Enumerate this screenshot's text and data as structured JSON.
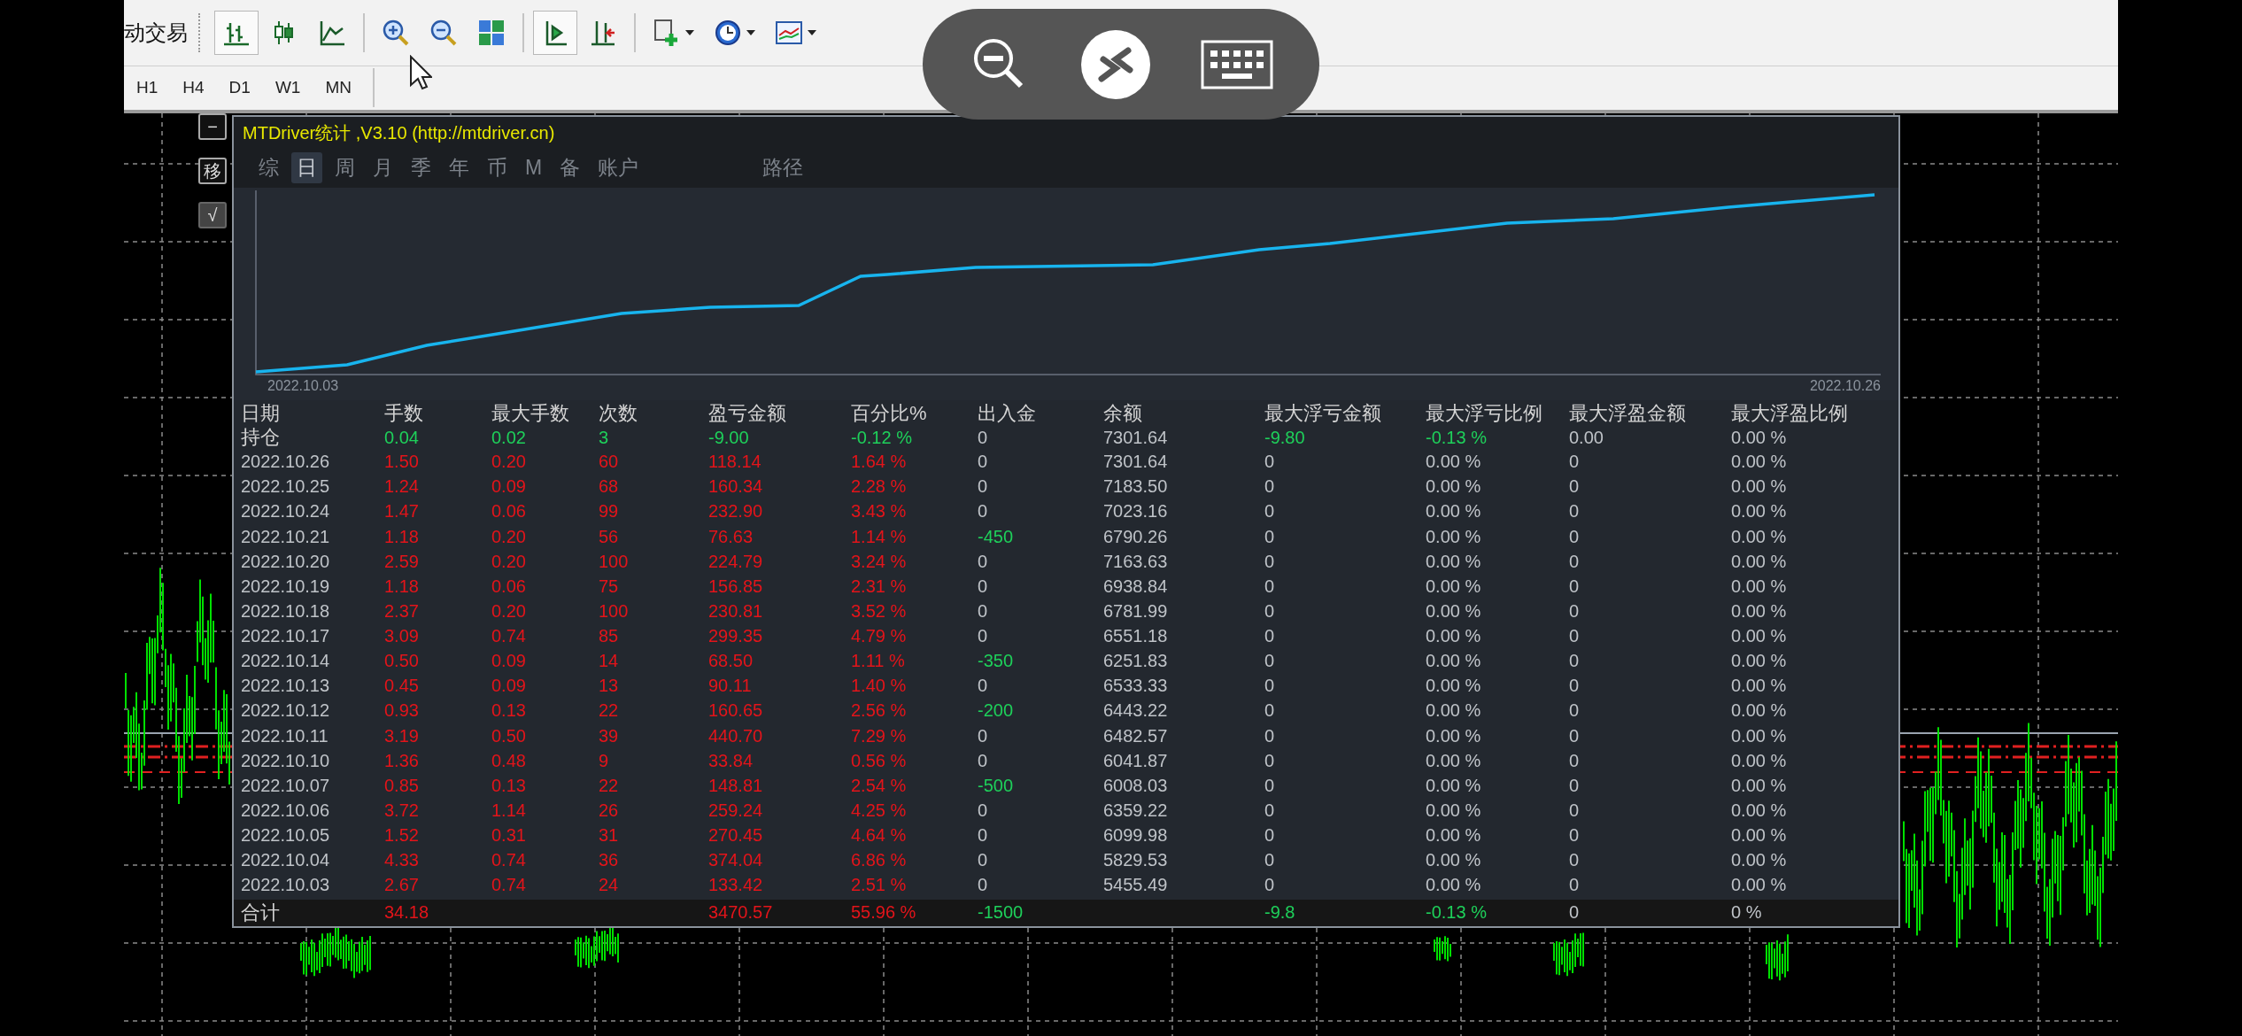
{
  "toolbar": {
    "label": "动交易",
    "tools": [
      {
        "kind": "bars",
        "pressed": true,
        "menu": false
      },
      {
        "kind": "candles",
        "pressed": false,
        "menu": false
      },
      {
        "kind": "line",
        "pressed": false,
        "menu": false
      },
      {
        "kind": "zoom-in",
        "pressed": false,
        "menu": false
      },
      {
        "kind": "zoom-out",
        "pressed": false,
        "menu": false
      },
      {
        "kind": "tile",
        "pressed": false,
        "menu": false
      },
      {
        "kind": "autoscroll",
        "pressed": true,
        "menu": false
      },
      {
        "kind": "shift",
        "pressed": false,
        "menu": false
      },
      {
        "kind": "indicators",
        "pressed": false,
        "menu": true
      },
      {
        "kind": "clock",
        "pressed": false,
        "menu": true
      },
      {
        "kind": "template",
        "pressed": false,
        "menu": true
      }
    ],
    "timeframes": [
      "H1",
      "H4",
      "D1",
      "W1",
      "MN"
    ]
  },
  "side_buttons": [
    "−",
    "移",
    "√"
  ],
  "panel": {
    "title": "MTDriver统计 ,V3.10 (http://mtdriver.cn)",
    "tabs": [
      {
        "label": "综",
        "selected": false
      },
      {
        "label": "日",
        "selected": true
      },
      {
        "label": "周",
        "selected": false
      },
      {
        "label": "月",
        "selected": false
      },
      {
        "label": "季",
        "selected": false
      },
      {
        "label": "年",
        "selected": false
      },
      {
        "label": "币",
        "selected": false
      },
      {
        "label": "M",
        "selected": false
      },
      {
        "label": "备",
        "selected": false
      },
      {
        "label": "账户",
        "selected": false
      }
    ],
    "path_tab": {
      "label": "路径",
      "selected": false
    },
    "chart": {
      "start_label": "2022.10.03",
      "end_label": "2022.10.26"
    },
    "columns": [
      "日期",
      "手数",
      "最大手数",
      "次数",
      "盈亏金额",
      "百分比%",
      "出入金",
      "余额",
      "最大浮亏金额",
      "最大浮亏比例",
      "最大浮盈金额",
      "最大浮盈比例"
    ],
    "rows": [
      {
        "kind": "position",
        "deposit_out": false,
        "cells": [
          "持仓",
          "0.04",
          "0.02",
          "3",
          "-9.00",
          "-0.12 %",
          "0",
          "7301.64",
          "-9.80",
          "-0.13 %",
          "0.00",
          "0.00 %"
        ]
      },
      {
        "kind": "day",
        "deposit_out": false,
        "cells": [
          "2022.10.26",
          "1.50",
          "0.20",
          "60",
          "118.14",
          "1.64 %",
          "0",
          "7301.64",
          "0",
          "0.00 %",
          "0",
          "0.00 %"
        ]
      },
      {
        "kind": "day",
        "deposit_out": false,
        "cells": [
          "2022.10.25",
          "1.24",
          "0.09",
          "68",
          "160.34",
          "2.28 %",
          "0",
          "7183.50",
          "0",
          "0.00 %",
          "0",
          "0.00 %"
        ]
      },
      {
        "kind": "day",
        "deposit_out": false,
        "cells": [
          "2022.10.24",
          "1.47",
          "0.06",
          "99",
          "232.90",
          "3.43 %",
          "0",
          "7023.16",
          "0",
          "0.00 %",
          "0",
          "0.00 %"
        ]
      },
      {
        "kind": "day",
        "deposit_out": true,
        "cells": [
          "2022.10.21",
          "1.18",
          "0.20",
          "56",
          "76.63",
          "1.14 %",
          "-450",
          "6790.26",
          "0",
          "0.00 %",
          "0",
          "0.00 %"
        ]
      },
      {
        "kind": "day",
        "deposit_out": false,
        "cells": [
          "2022.10.20",
          "2.59",
          "0.20",
          "100",
          "224.79",
          "3.24 %",
          "0",
          "7163.63",
          "0",
          "0.00 %",
          "0",
          "0.00 %"
        ]
      },
      {
        "kind": "day",
        "deposit_out": false,
        "cells": [
          "2022.10.19",
          "1.18",
          "0.06",
          "75",
          "156.85",
          "2.31 %",
          "0",
          "6938.84",
          "0",
          "0.00 %",
          "0",
          "0.00 %"
        ]
      },
      {
        "kind": "day",
        "deposit_out": false,
        "cells": [
          "2022.10.18",
          "2.37",
          "0.20",
          "100",
          "230.81",
          "3.52 %",
          "0",
          "6781.99",
          "0",
          "0.00 %",
          "0",
          "0.00 %"
        ]
      },
      {
        "kind": "day",
        "deposit_out": false,
        "cells": [
          "2022.10.17",
          "3.09",
          "0.74",
          "85",
          "299.35",
          "4.79 %",
          "0",
          "6551.18",
          "0",
          "0.00 %",
          "0",
          "0.00 %"
        ]
      },
      {
        "kind": "day",
        "deposit_out": true,
        "cells": [
          "2022.10.14",
          "0.50",
          "0.09",
          "14",
          "68.50",
          "1.11 %",
          "-350",
          "6251.83",
          "0",
          "0.00 %",
          "0",
          "0.00 %"
        ]
      },
      {
        "kind": "day",
        "deposit_out": false,
        "cells": [
          "2022.10.13",
          "0.45",
          "0.09",
          "13",
          "90.11",
          "1.40 %",
          "0",
          "6533.33",
          "0",
          "0.00 %",
          "0",
          "0.00 %"
        ]
      },
      {
        "kind": "day",
        "deposit_out": true,
        "cells": [
          "2022.10.12",
          "0.93",
          "0.13",
          "22",
          "160.65",
          "2.56 %",
          "-200",
          "6443.22",
          "0",
          "0.00 %",
          "0",
          "0.00 %"
        ]
      },
      {
        "kind": "day",
        "deposit_out": false,
        "cells": [
          "2022.10.11",
          "3.19",
          "0.50",
          "39",
          "440.70",
          "7.29 %",
          "0",
          "6482.57",
          "0",
          "0.00 %",
          "0",
          "0.00 %"
        ]
      },
      {
        "kind": "day",
        "deposit_out": false,
        "cells": [
          "2022.10.10",
          "1.36",
          "0.48",
          "9",
          "33.84",
          "0.56 %",
          "0",
          "6041.87",
          "0",
          "0.00 %",
          "0",
          "0.00 %"
        ]
      },
      {
        "kind": "day",
        "deposit_out": true,
        "cells": [
          "2022.10.07",
          "0.85",
          "0.13",
          "22",
          "148.81",
          "2.54 %",
          "-500",
          "6008.03",
          "0",
          "0.00 %",
          "0",
          "0.00 %"
        ]
      },
      {
        "kind": "day",
        "deposit_out": false,
        "cells": [
          "2022.10.06",
          "3.72",
          "1.14",
          "26",
          "259.24",
          "4.25 %",
          "0",
          "6359.22",
          "0",
          "0.00 %",
          "0",
          "0.00 %"
        ]
      },
      {
        "kind": "day",
        "deposit_out": false,
        "cells": [
          "2022.10.05",
          "1.52",
          "0.31",
          "31",
          "270.45",
          "4.64 %",
          "0",
          "6099.98",
          "0",
          "0.00 %",
          "0",
          "0.00 %"
        ]
      },
      {
        "kind": "day",
        "deposit_out": false,
        "cells": [
          "2022.10.04",
          "4.33",
          "0.74",
          "36",
          "374.04",
          "6.86 %",
          "0",
          "5829.53",
          "0",
          "0.00 %",
          "0",
          "0.00 %"
        ]
      },
      {
        "kind": "day",
        "deposit_out": false,
        "cells": [
          "2022.10.03",
          "2.67",
          "0.74",
          "24",
          "133.42",
          "2.51 %",
          "0",
          "5455.49",
          "0",
          "0.00 %",
          "0",
          "0.00 %"
        ]
      },
      {
        "kind": "total",
        "deposit_out": true,
        "cells": [
          "合计",
          "34.18",
          null,
          null,
          "3470.57",
          "55.96 %",
          "-1500",
          null,
          "-9.8",
          "-0.13 %",
          "0",
          "0 %"
        ]
      }
    ]
  }
}
